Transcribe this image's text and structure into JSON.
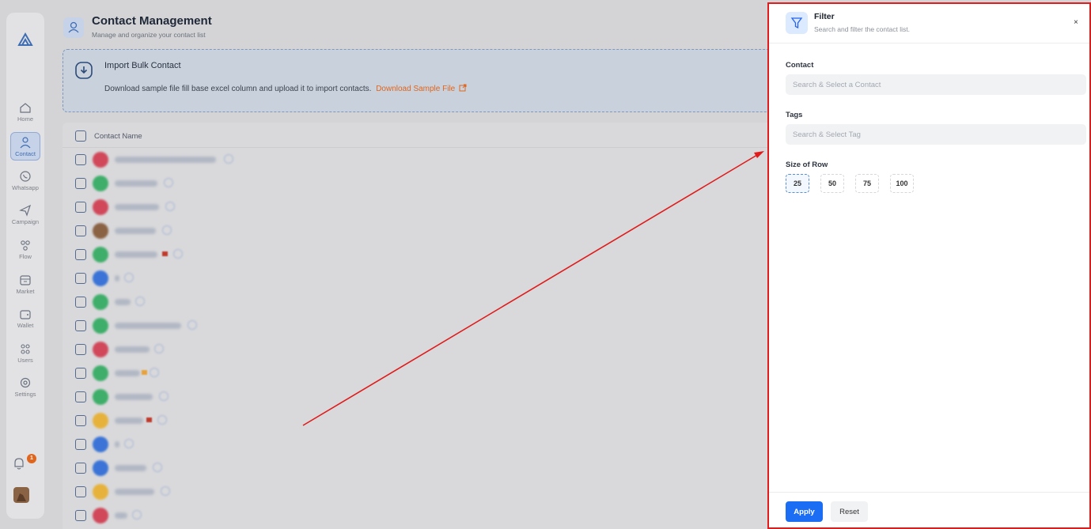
{
  "sidebar": {
    "items": [
      {
        "label": "Home",
        "icon": "home-icon"
      },
      {
        "label": "Contact",
        "icon": "contact-icon"
      },
      {
        "label": "Whatsapp",
        "icon": "whatsapp-icon"
      },
      {
        "label": "Campaign",
        "icon": "send-icon"
      },
      {
        "label": "Flow",
        "icon": "flow-icon"
      },
      {
        "label": "Market",
        "icon": "market-icon"
      },
      {
        "label": "Wallet",
        "icon": "wallet-icon"
      },
      {
        "label": "Users",
        "icon": "users-icon"
      },
      {
        "label": "Settings",
        "icon": "settings-icon"
      }
    ],
    "active": "Contact",
    "notification_count": "1"
  },
  "header": {
    "title": "Contact Management",
    "subtitle": "Manage and organize your contact list"
  },
  "import": {
    "title": "Import Bulk Contact",
    "description": "Download sample file fill base excel column and upload it to import contacts.",
    "link_label": "Download Sample File"
  },
  "table": {
    "column_header": "Contact Name"
  },
  "filter": {
    "title": "Filter",
    "subtitle": "Search and filter the contact list.",
    "close_label": "×",
    "contact_label": "Contact",
    "contact_placeholder": "Search & Select a Contact",
    "tags_label": "Tags",
    "tags_placeholder": "Search & Select Tag",
    "size_label": "Size of Row",
    "sizes": [
      "25",
      "50",
      "75",
      "100"
    ],
    "selected_size": "25",
    "apply_label": "Apply",
    "reset_label": "Reset"
  },
  "colors": {
    "accent": "#1b6ef3",
    "link": "#e0651d",
    "highlight_border": "#e01b1b"
  }
}
